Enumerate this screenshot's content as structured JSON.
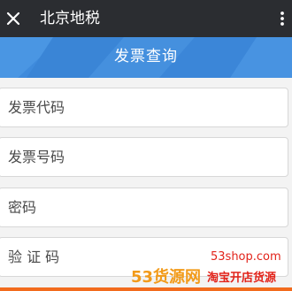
{
  "app_bar": {
    "title": "北京地税",
    "close_icon": "close-icon",
    "more_icon": "more-vertical-icon",
    "background_color": "#2b2d31"
  },
  "banner": {
    "title": "发票查询",
    "background_color": "#3f8bdc"
  },
  "form": {
    "fields": [
      {
        "placeholder": "发票代码",
        "value": ""
      },
      {
        "placeholder": "发票号码",
        "value": ""
      },
      {
        "placeholder": "密码",
        "value": ""
      },
      {
        "placeholder": "验 证 码",
        "value": ""
      }
    ]
  },
  "watermark": {
    "left_text": "53货源网",
    "url": "53shop.com",
    "right_text": "淘宝开店货源",
    "accent_color": "#f29a19",
    "url_color": "#e2231a"
  }
}
